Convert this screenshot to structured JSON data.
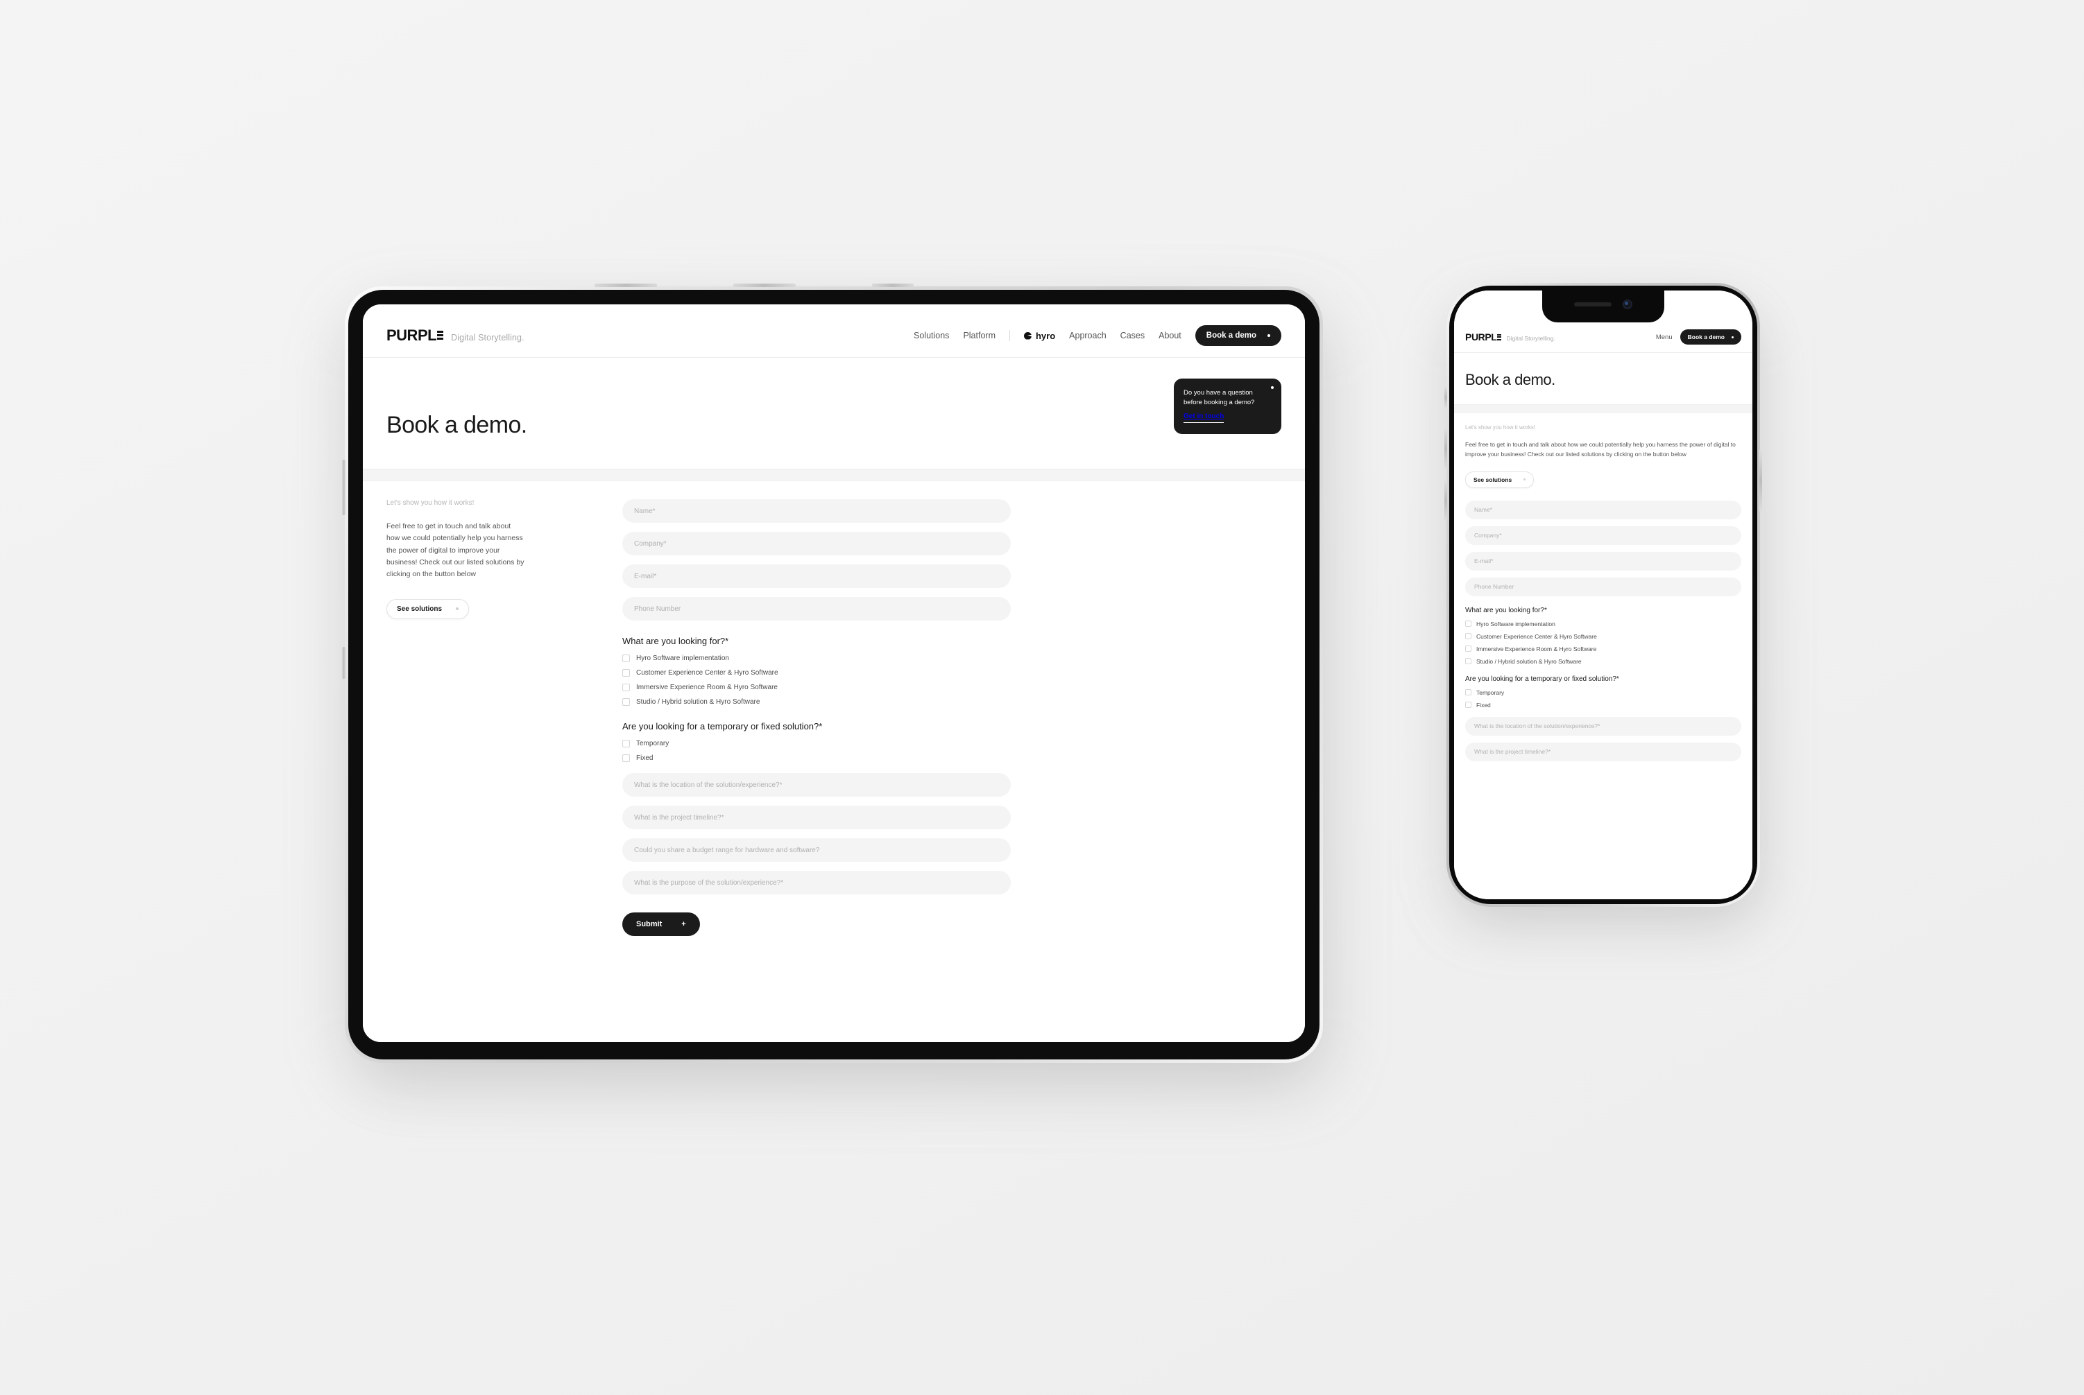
{
  "brand": {
    "logo_text": "PURPL",
    "tagline": "Digital Storytelling."
  },
  "nav": {
    "items": [
      {
        "label": "Solutions"
      },
      {
        "label": "Platform"
      },
      {
        "label": "Approach"
      },
      {
        "label": "Cases"
      },
      {
        "label": "About"
      }
    ],
    "partner_logo": "hyro",
    "cta_label": "Book a demo",
    "menu_label": "Menu"
  },
  "hero": {
    "title": "Book a demo.",
    "card": {
      "line1": "Do you have a question",
      "line2": "before booking a demo?",
      "link": "Get in touch"
    }
  },
  "intro": {
    "eyebrow": "Let's show you how it works!",
    "body": "Feel free to get in touch and talk about how we could potentially help you harness the power of digital to improve your business! Check out our listed solutions by clicking on the button below",
    "cta_label": "See solutions"
  },
  "form": {
    "fields_top": [
      {
        "placeholder": "Name*"
      },
      {
        "placeholder": "Company*"
      },
      {
        "placeholder": "E-mail*"
      },
      {
        "placeholder": "Phone Number"
      }
    ],
    "question_1": {
      "label": "What are you looking for?*",
      "options": [
        {
          "label": "Hyro Software implementation"
        },
        {
          "label": "Customer Experience Center & Hyro Software"
        },
        {
          "label": "Immersive Experience Room & Hyro Software"
        },
        {
          "label": "Studio / Hybrid solution & Hyro Software"
        }
      ]
    },
    "question_2": {
      "label": "Are you looking for a temporary or fixed solution?*",
      "options": [
        {
          "label": "Temporary"
        },
        {
          "label": "Fixed"
        }
      ]
    },
    "fields_bottom": [
      {
        "placeholder": "What is the location of the solution/experience?*"
      },
      {
        "placeholder": "What is the project timeline?*"
      },
      {
        "placeholder": "Could you share a budget range for hardware and software?"
      },
      {
        "placeholder": "What is the purpose of the solution/experience?*"
      }
    ],
    "submit_label": "Submit",
    "submit_icon": "plus-icon"
  },
  "colors": {
    "accent_dark": "#1b1b1b",
    "field_bg": "#f4f4f4",
    "page_bg": "#f2f2f2",
    "muted_text": "#b0b0b0"
  }
}
